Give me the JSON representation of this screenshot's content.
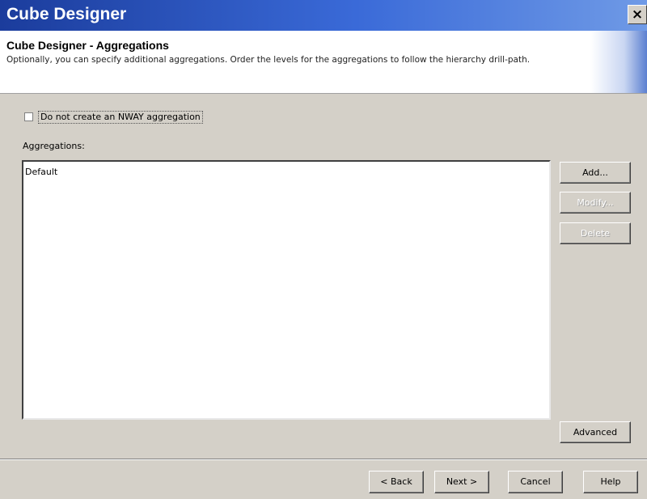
{
  "window": {
    "title": "Cube Designer",
    "close_glyph": "×"
  },
  "header": {
    "title": "Cube Designer - Aggregations",
    "description": "Optionally, you can specify additional aggregations. Order the levels for the aggregations to follow the hierarchy drill-path."
  },
  "options": {
    "nway_checkbox_label": "Do not create an NWAY aggregation",
    "nway_checked": false
  },
  "aggregations": {
    "label": "Aggregations:",
    "items": [
      "Default"
    ]
  },
  "side_buttons": {
    "add": "Add...",
    "modify": "Modify...",
    "delete": "Delete",
    "advanced": "Advanced"
  },
  "nav_buttons": {
    "back": "< Back",
    "next": "Next >",
    "cancel": "Cancel",
    "help": "Help"
  },
  "colors": {
    "titlebar": "#1b3c9c",
    "dialog_bg": "#d4d0c8"
  }
}
